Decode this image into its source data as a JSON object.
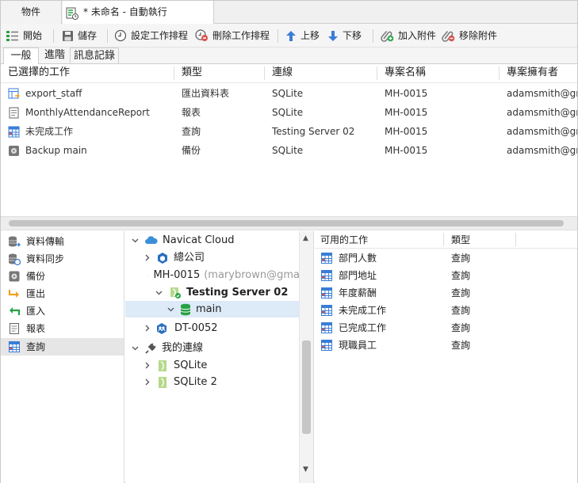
{
  "tabs": {
    "objects": "物件",
    "active": "* 未命名 - 自動執行"
  },
  "toolbar": {
    "start": "開始",
    "save": "儲存",
    "set_schedule": "設定工作排程",
    "delete_schedule": "刪除工作排程",
    "move_up": "上移",
    "move_down": "下移",
    "add_attachment": "加入附件",
    "remove_attachment": "移除附件"
  },
  "subtabs": [
    "一般",
    "進階",
    "訊息記錄"
  ],
  "selected_jobs": {
    "headers": [
      "已選擇的工作",
      "類型",
      "連線",
      "專案名稱",
      "專案擁有者"
    ],
    "rows": [
      {
        "name": "export_staff",
        "type": "匯出資料表",
        "connection": "SQLite",
        "project": "MH-0015",
        "owner": "adamsmith@gma",
        "icon": "export-table-icon"
      },
      {
        "name": "MonthlyAttendanceReport",
        "type": "報表",
        "connection": "SQLite",
        "project": "MH-0015",
        "owner": "adamsmith@gma",
        "icon": "report-icon"
      },
      {
        "name": "未完成工作",
        "type": "查詢",
        "connection": "Testing Server 02",
        "project": "MH-0015",
        "owner": "adamsmith@gma",
        "icon": "query-icon"
      },
      {
        "name": "Backup main",
        "type": "備份",
        "connection": "SQLite",
        "project": "MH-0015",
        "owner": "adamsmith@gma",
        "icon": "backup-icon"
      }
    ]
  },
  "left_nav": {
    "items": [
      {
        "label": "資料傳輸",
        "icon": "data-transfer-icon"
      },
      {
        "label": "資料同步",
        "icon": "data-sync-icon"
      },
      {
        "label": "備份",
        "icon": "backup-icon"
      },
      {
        "label": "匯出",
        "icon": "export-icon"
      },
      {
        "label": "匯入",
        "icon": "import-icon"
      },
      {
        "label": "報表",
        "icon": "report-icon"
      },
      {
        "label": "查詢",
        "icon": "query-icon"
      }
    ],
    "selected": "查詢"
  },
  "tree": {
    "cloud": "Navicat Cloud",
    "head_office": "總公司",
    "project": "MH-0015",
    "project_owner": "(marybrown@gma",
    "server": "Testing Server 02",
    "database": "main",
    "project2": "DT-0052",
    "my_connections": "我的連線",
    "conn1": "SQLite",
    "conn2": "SQLite 2"
  },
  "available": {
    "headers": [
      "可用的工作",
      "類型"
    ],
    "rows": [
      {
        "name": "部門人數",
        "type": "查詢"
      },
      {
        "name": "部門地址",
        "type": "查詢"
      },
      {
        "name": "年度薪酬",
        "type": "查詢"
      },
      {
        "name": "未完成工作",
        "type": "查詢"
      },
      {
        "name": "已完成工作",
        "type": "查詢"
      },
      {
        "name": "現職員工",
        "type": "查詢"
      }
    ]
  },
  "colors": {
    "accent": "#3a7dd8",
    "selected_row": "#ddeaf7",
    "green": "#27a243",
    "red": "#d9534f",
    "orange": "#f0a020"
  }
}
